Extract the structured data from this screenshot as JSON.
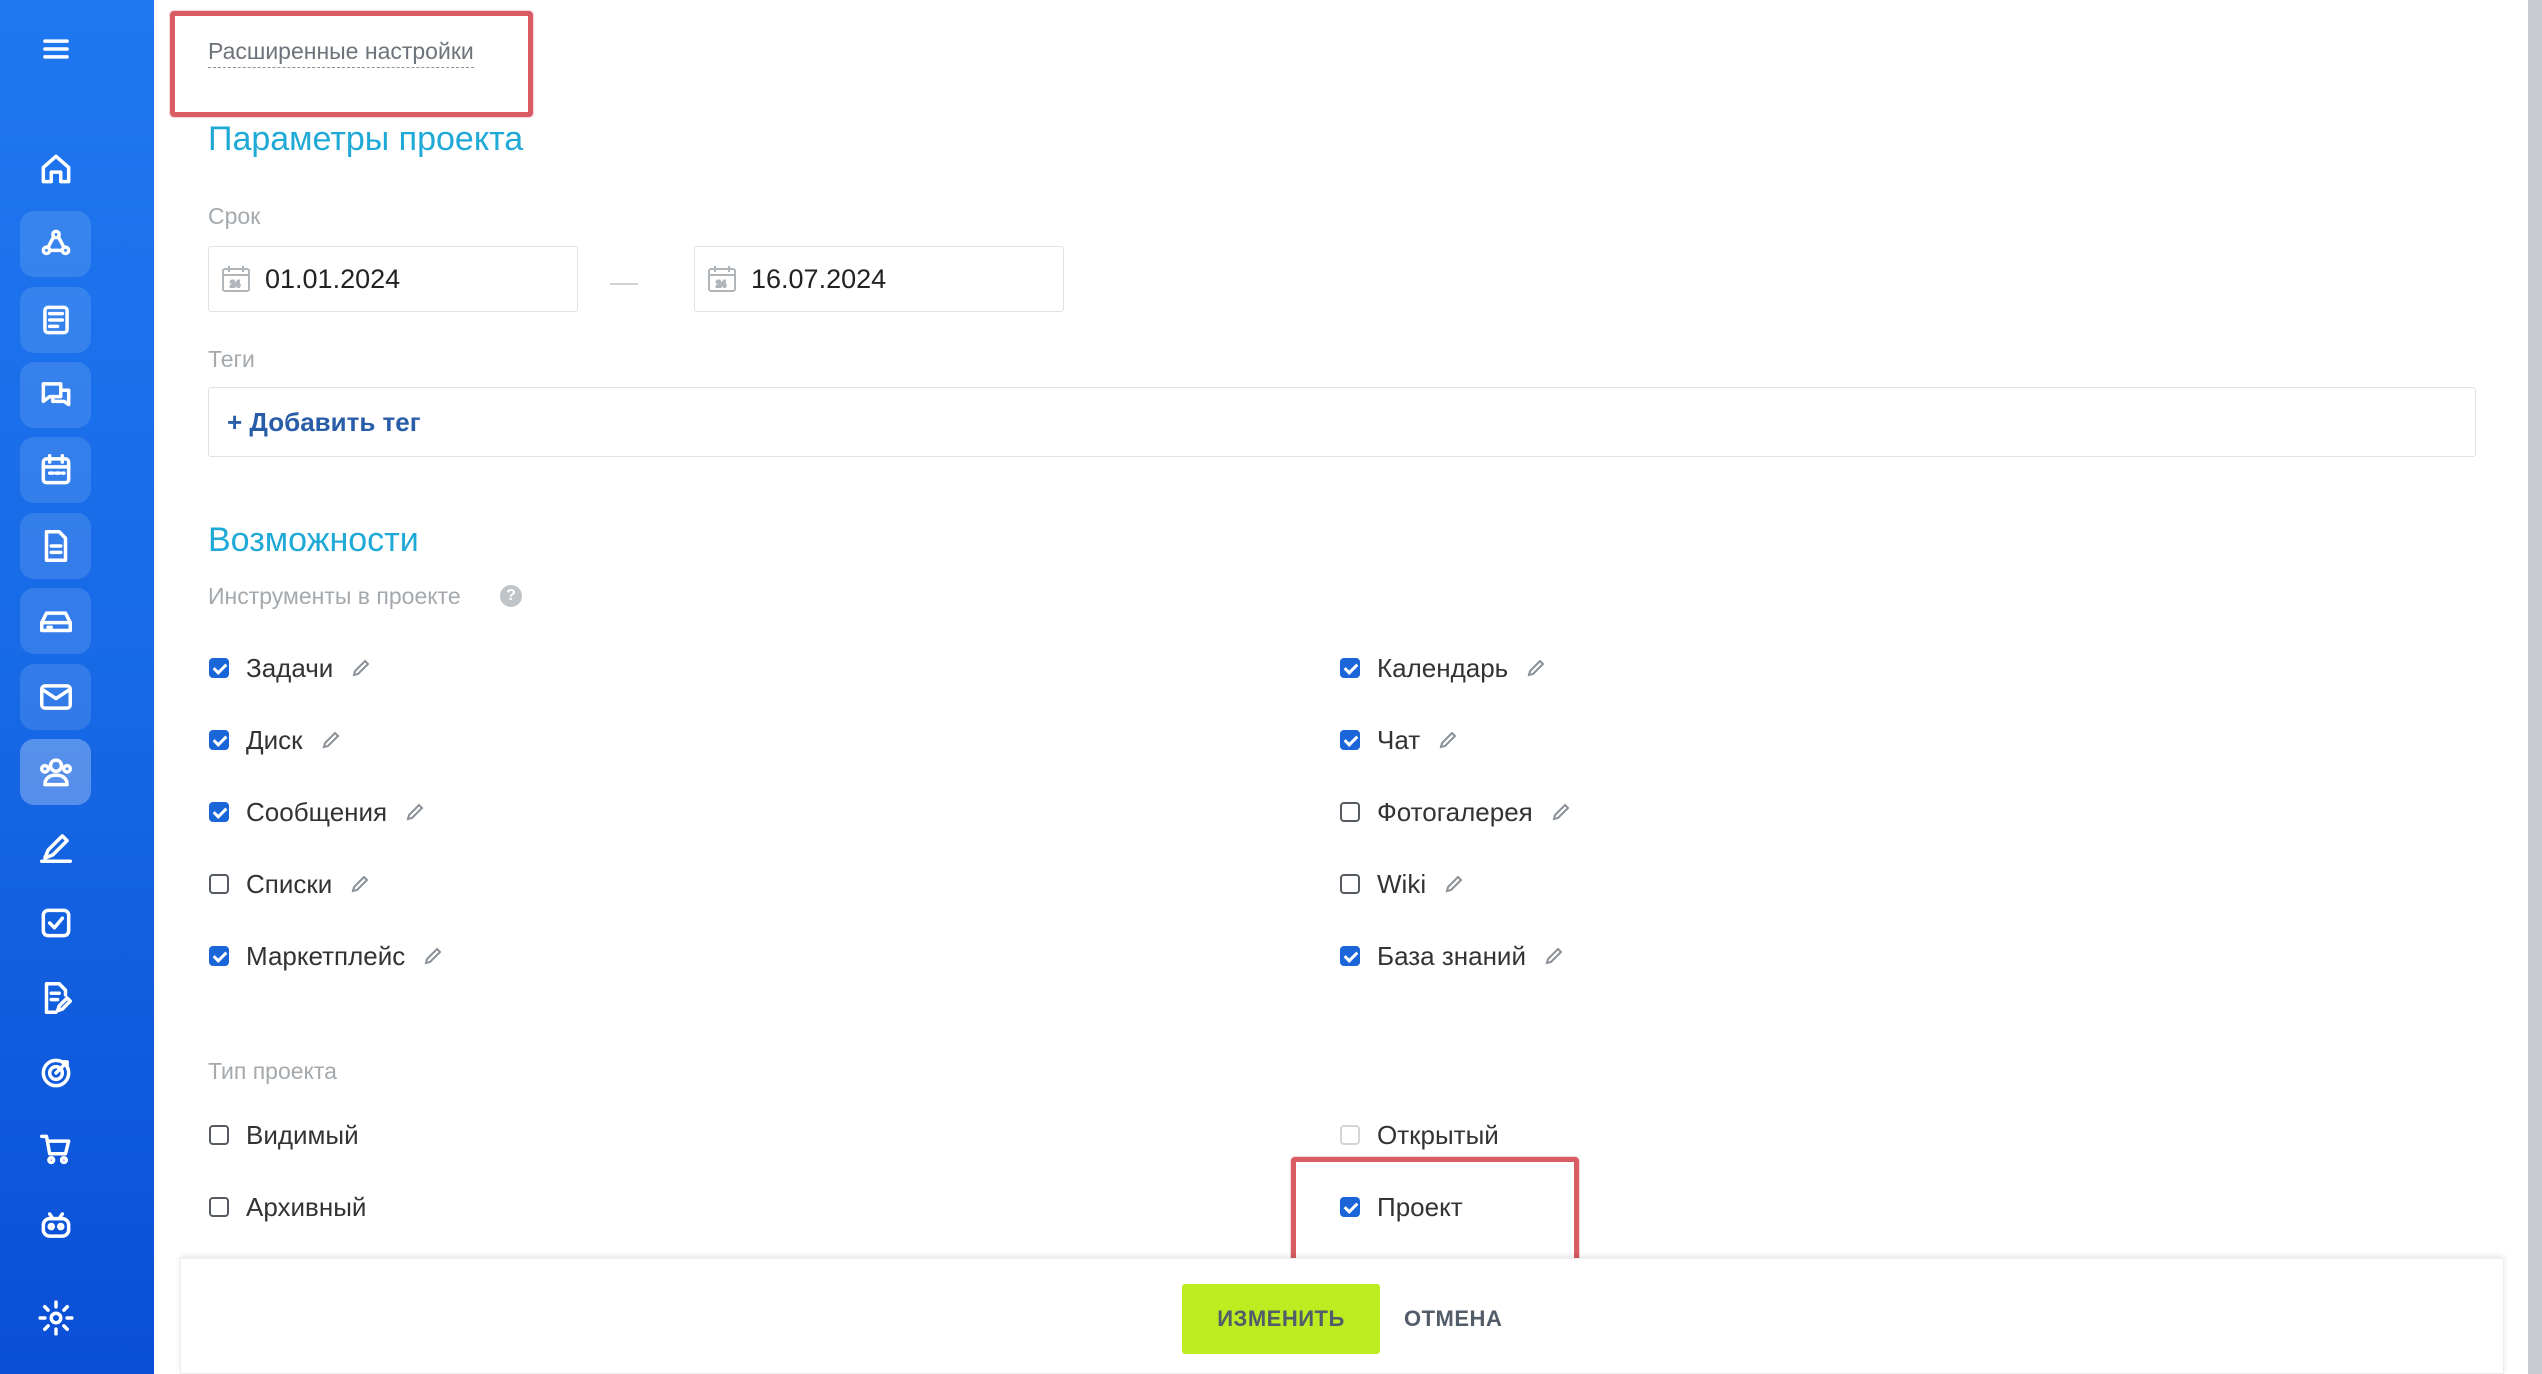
{
  "sidebar": {
    "items": [
      {
        "icon": "menu-icon"
      },
      {
        "icon": "home-icon"
      },
      {
        "icon": "crm-icon"
      },
      {
        "icon": "news-feed-icon"
      },
      {
        "icon": "chat-icon"
      },
      {
        "icon": "calendar-icon"
      },
      {
        "icon": "document-icon"
      },
      {
        "icon": "drive-icon"
      },
      {
        "icon": "mail-icon"
      },
      {
        "icon": "groups-icon"
      },
      {
        "icon": "sign-icon"
      },
      {
        "icon": "tasks-icon"
      },
      {
        "icon": "document-edit-icon"
      },
      {
        "icon": "target-icon"
      },
      {
        "icon": "cart-icon"
      },
      {
        "icon": "robot-icon"
      },
      {
        "icon": "settings-icon"
      }
    ],
    "active": "groups-icon"
  },
  "advanced_link": "Расширенные настройки",
  "params": {
    "title": "Параметры проекта",
    "term_label": "Срок",
    "date_from": "01.01.2024",
    "date_to": "16.07.2024",
    "tags_label": "Теги",
    "add_tag": "+ Добавить тег"
  },
  "features": {
    "title": "Возможности",
    "tools_label": "Инструменты в проекте",
    "help": "?",
    "tools_left": [
      {
        "label": "Задачи",
        "checked": true
      },
      {
        "label": "Диск",
        "checked": true
      },
      {
        "label": "Сообщения",
        "checked": true
      },
      {
        "label": "Списки",
        "checked": false
      },
      {
        "label": "Маркетплейс",
        "checked": true
      }
    ],
    "tools_right": [
      {
        "label": "Календарь",
        "checked": true
      },
      {
        "label": "Чат",
        "checked": true
      },
      {
        "label": "Фотогалерея",
        "checked": false
      },
      {
        "label": "Wiki",
        "checked": false
      },
      {
        "label": "База знаний",
        "checked": true
      }
    ]
  },
  "project_type": {
    "label": "Тип проекта",
    "visible": "Видимый",
    "archived": "Архивный",
    "open": "Открытый",
    "project": "Проект"
  },
  "footer": {
    "save": "ИЗМЕНИТЬ",
    "cancel": "ОТМЕНА"
  },
  "colors": {
    "sidebar": "#1769e6",
    "accent_title": "#1fa9d6",
    "checkbox": "#1a66d9",
    "save_button": "#bbed21",
    "highlight": "#d95b63"
  }
}
